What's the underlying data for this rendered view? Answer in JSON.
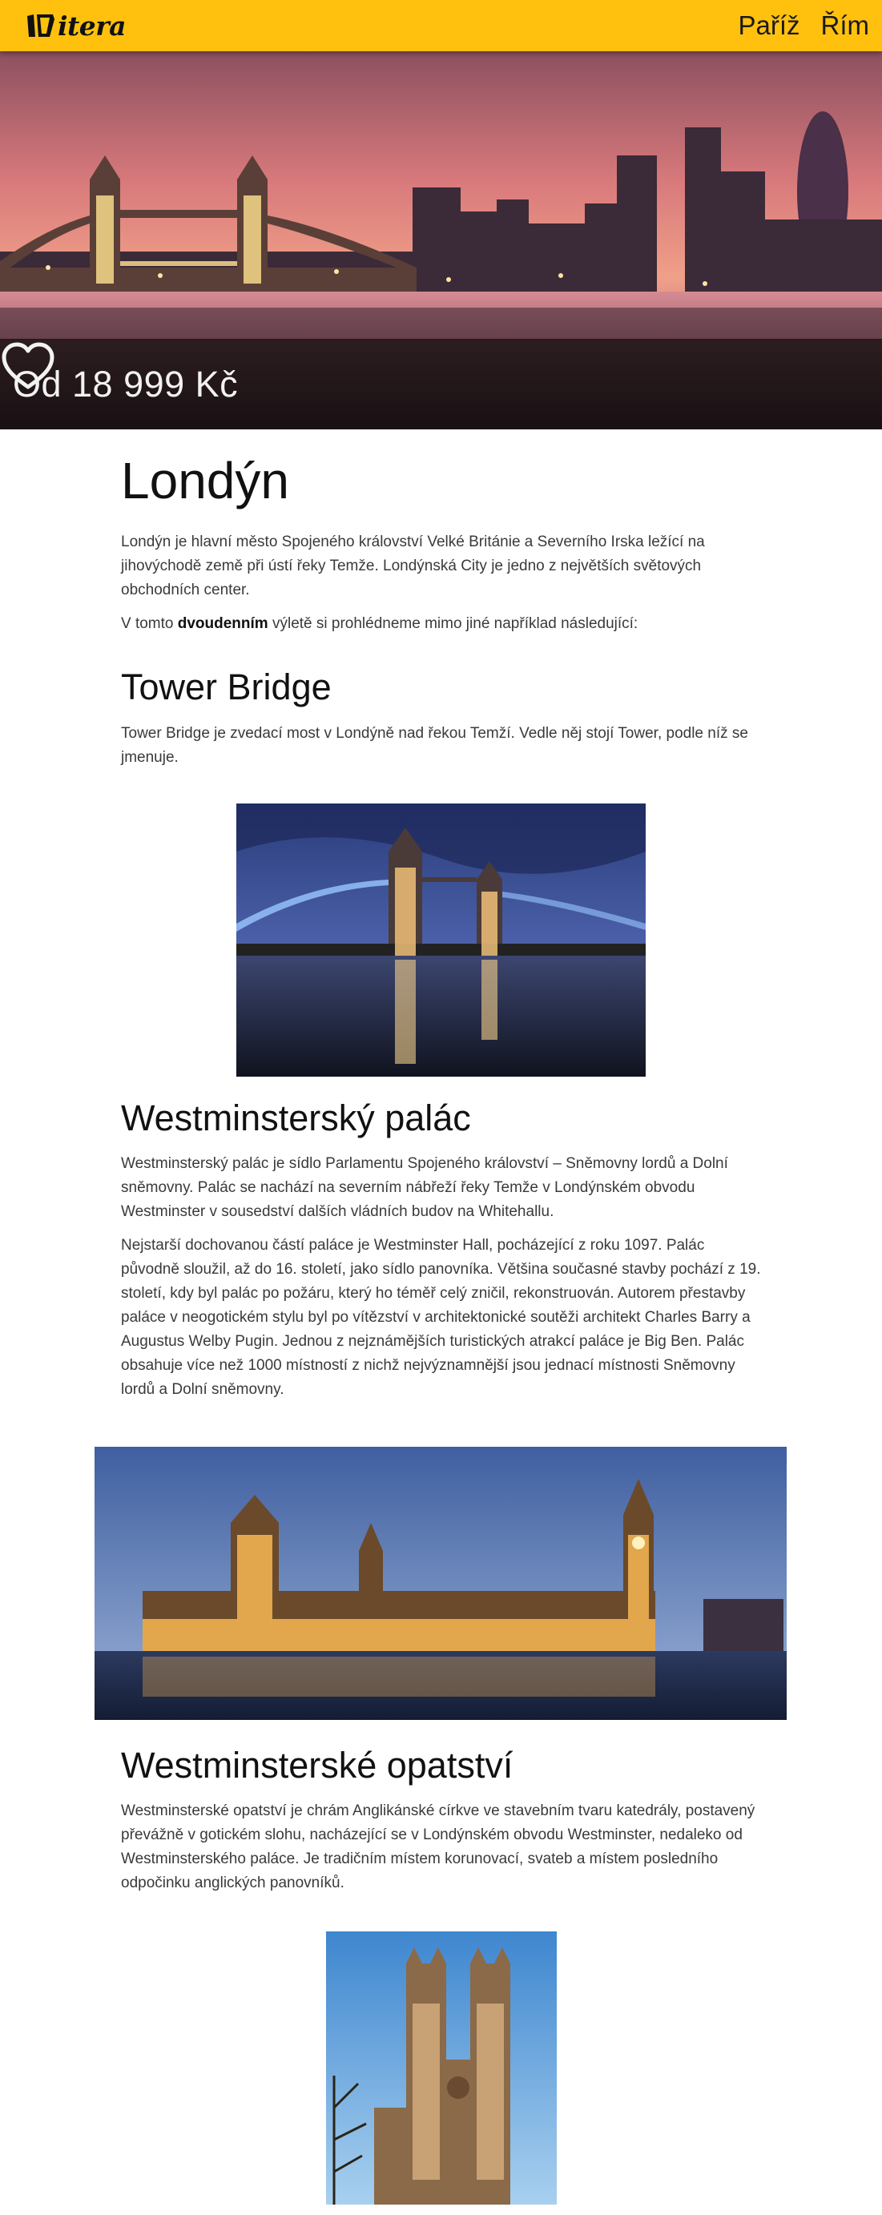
{
  "brand": {
    "logo_text": "itera"
  },
  "nav": {
    "items": [
      "Paříž",
      "Řím"
    ]
  },
  "hero": {
    "price": "Od 18 999 Kč"
  },
  "colors": {
    "header": "#ffc10e",
    "text": "#3a3a3a",
    "heading": "#111111"
  },
  "article": {
    "title": "Londýn",
    "intro": "Londýn je hlavní město Spojeného království Velké Británie a Severního Irska ležící na jihovýchodě země při ústí řeky Temže. Londýnská City je jedno z největších světových obchodních center.",
    "trip_before": "V tomto ",
    "trip_bold": "dvoudenním",
    "trip_after": " výletě si prohlédneme mimo jiné například následující:",
    "sections": [
      {
        "title": "Tower Bridge",
        "paragraphs": [
          "Tower Bridge je zvedací most v Londýně nad řekou Temží. Vedle něj stojí Tower, podle níž se jmenuje."
        ]
      },
      {
        "title": "Westminsterský palác",
        "paragraphs": [
          "Westminsterský palác je sídlo Parlamentu Spojeného království – Sněmovny lordů a Dolní sněmovny. Palác se nachází na severním nábřeží řeky Temže v Londýnském obvodu Westminster v sousedství dalších vládních budov na Whitehallu.",
          "Nejstarší dochovanou částí paláce je Westminster Hall, pocházející z roku 1097. Palác původně sloužil, až do 16. století, jako sídlo panovníka. Většina současné stavby pochází z 19. století, kdy byl palác po požáru, který ho téměř celý zničil, rekonstruován. Autorem přestavby paláce v neogotickém stylu byl po vítězství v architektonické soutěži architekt Charles Barry a Augustus Welby Pugin. Jednou z nejznámějších turistických atrakcí paláce je Big Ben. Palác obsahuje více než 1000 místností z nichž nejvýznamnější jsou jednací místnosti Sněmovny lordů a Dolní sněmovny."
        ]
      },
      {
        "title": "Westminsterské opatství",
        "paragraphs": [
          "Westminsterské opatství je chrám Anglikánské církve ve stavebním tvaru katedrály, postavený převážně v gotickém slohu, nacházející se v Londýnském obvodu Westminster, nedaleko od Westminsterského paláce. Je tradičním místem korunovací, svateb a místem posledního odpočinku anglických panovníků."
        ]
      }
    ]
  }
}
